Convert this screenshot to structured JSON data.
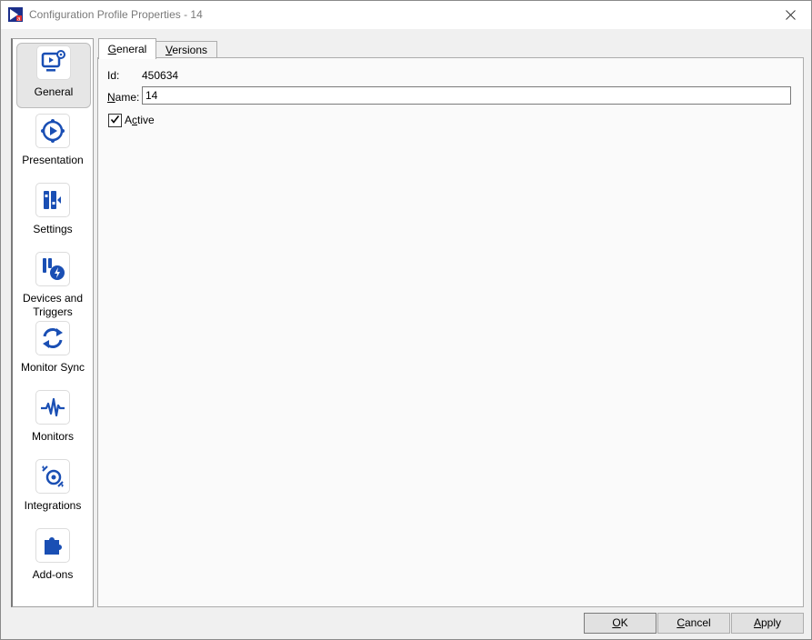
{
  "window": {
    "title": "Configuration Profile Properties - 14"
  },
  "nav": {
    "items": [
      {
        "label": "General",
        "icon": "monitor-settings-icon",
        "selected": true
      },
      {
        "label": "Presentation",
        "icon": "presentation-play-icon"
      },
      {
        "label": "Settings",
        "icon": "settings-panel-icon"
      },
      {
        "label": "Devices and Triggers",
        "icon": "devices-triggers-icon"
      },
      {
        "label": "Monitor Sync",
        "icon": "monitor-sync-icon"
      },
      {
        "label": "Monitors",
        "icon": "monitors-pulse-icon"
      },
      {
        "label": "Integrations",
        "icon": "integrations-icon"
      },
      {
        "label": "Add-ons",
        "icon": "puzzle-icon"
      }
    ]
  },
  "tabs": [
    {
      "label": "General",
      "mnemonic": "G",
      "rest": "eneral",
      "active": true
    },
    {
      "label": "Versions",
      "mnemonic": "V",
      "rest": "ersions",
      "active": false
    }
  ],
  "general": {
    "id_label": "Id:",
    "id_value": "450634",
    "name_label_mnemonic": "N",
    "name_label_rest": "ame:",
    "name_value": "14",
    "active_label_pre": "A",
    "active_label_mnemonic": "c",
    "active_label_rest": "tive",
    "active_checked": true
  },
  "buttons": {
    "ok": {
      "mnemonic": "O",
      "rest": "K"
    },
    "cancel": {
      "mnemonic": "C",
      "rest": "ancel"
    },
    "apply": {
      "mnemonic": "A",
      "rest": "pply"
    }
  },
  "colors": {
    "accent": "#1a4fb4",
    "selected_nav": "#e6e6e6"
  }
}
